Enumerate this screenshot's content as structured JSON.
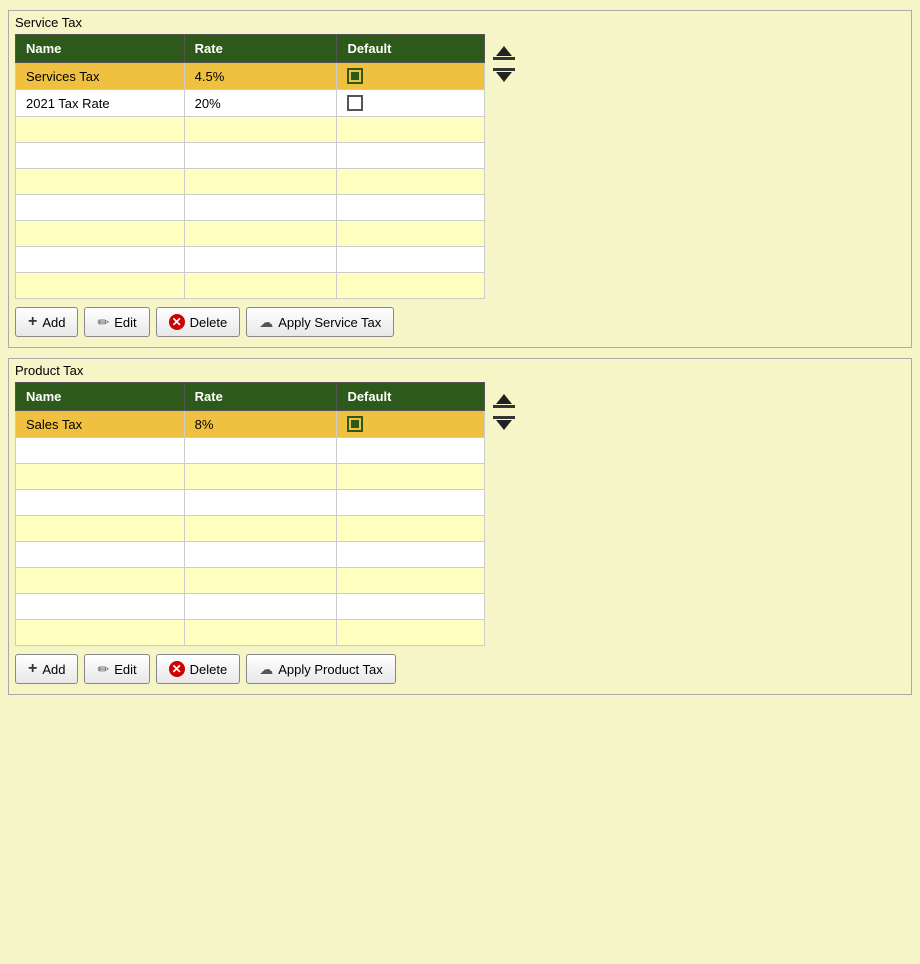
{
  "serviceTax": {
    "title": "Service Tax",
    "columns": [
      "Name",
      "Rate",
      "Default"
    ],
    "rows": [
      {
        "name": "Services Tax",
        "rate": "4.5%",
        "default": true,
        "selected": true
      },
      {
        "name": "2021 Tax Rate",
        "rate": "20%",
        "default": false,
        "selected": false
      }
    ],
    "emptyRows": 7,
    "buttons": {
      "add": "Add",
      "edit": "Edit",
      "delete": "Delete",
      "apply": "Apply Service Tax"
    }
  },
  "productTax": {
    "title": "Product Tax",
    "columns": [
      "Name",
      "Rate",
      "Default"
    ],
    "rows": [
      {
        "name": "Sales Tax",
        "rate": "8%",
        "default": true,
        "selected": true
      }
    ],
    "emptyRows": 8,
    "buttons": {
      "add": "Add",
      "edit": "Edit",
      "delete": "Delete",
      "apply": "Apply Product Tax"
    }
  }
}
